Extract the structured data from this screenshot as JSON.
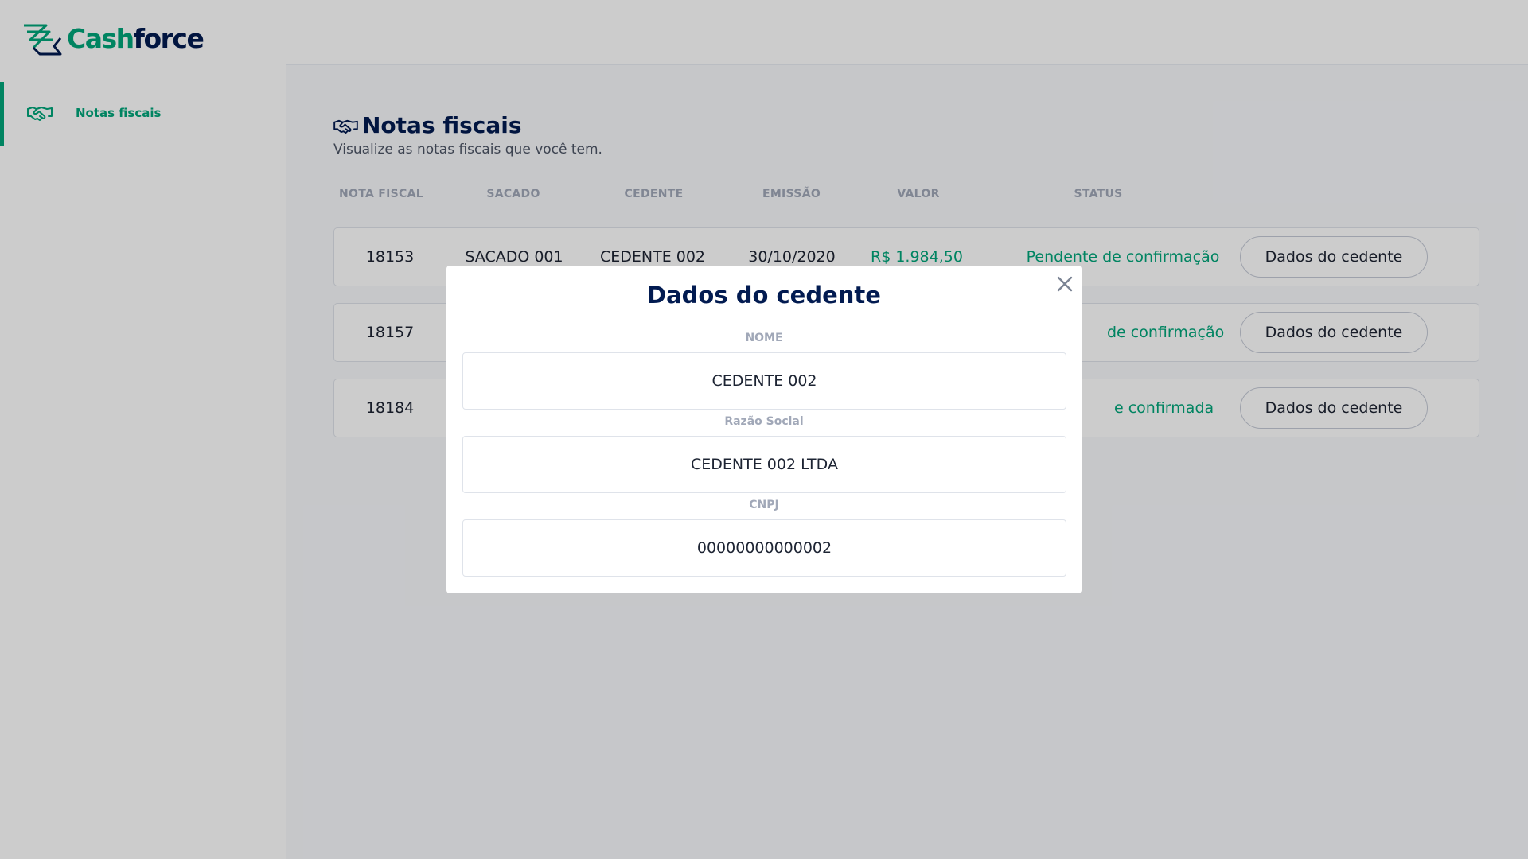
{
  "app": {
    "brand_part1": "Cash",
    "brand_part2": "force",
    "accent_color": "#00a57a",
    "navy_color": "#021b51"
  },
  "sidebar": {
    "items": [
      {
        "label": "Notas fiscais",
        "icon": "handshake-icon",
        "active": true
      }
    ]
  },
  "page": {
    "title": "Notas fiscais",
    "subtitle": "Visualize as notas fiscais que você tem.",
    "title_icon": "handshake-icon"
  },
  "table": {
    "headers": [
      "NOTA FISCAL",
      "SACADO",
      "CEDENTE",
      "EMISSÃO",
      "VALOR",
      "STATUS"
    ],
    "rows": [
      {
        "nota": "18153",
        "sacado": "SACADO 001",
        "cedente": "CEDENTE 002",
        "emissao": "30/10/2020",
        "valor": "R$ 1.984,50",
        "status": "Pendente de confirmação",
        "button": "Dados do cedente"
      },
      {
        "nota": "18157",
        "status_visible": "de confirmação",
        "button": "Dados do cedente"
      },
      {
        "nota": "18184",
        "status_visible": "e confirmada",
        "button": "Dados do cedente"
      }
    ]
  },
  "modal": {
    "title": "Dados do cedente",
    "close_icon": "close-icon",
    "fields": [
      {
        "label": "NOME",
        "value": "CEDENTE 002"
      },
      {
        "label": "Razão Social",
        "value": "CEDENTE 002 LTDA"
      },
      {
        "label": "CNPJ",
        "value": "00000000000002"
      }
    ]
  }
}
